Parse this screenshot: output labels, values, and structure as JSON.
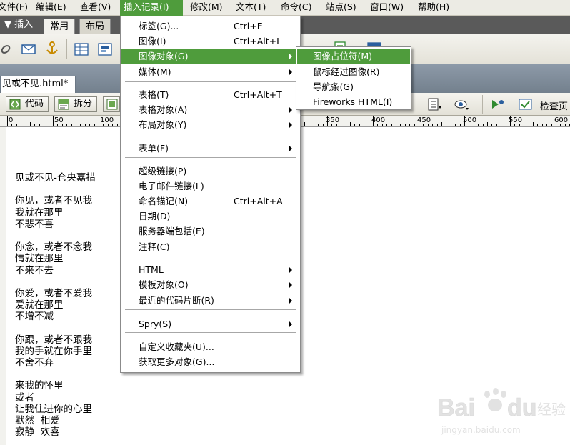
{
  "menubar": {
    "items": [
      "文件(F)",
      "编辑(E)",
      "查看(V)",
      "插入记录(I)",
      "修改(M)",
      "文本(T)",
      "命令(C)",
      "站点(S)",
      "窗口(W)",
      "帮助(H)"
    ]
  },
  "insert_panel": {
    "title": "▼ 插入",
    "tabs": [
      "常用",
      "布局"
    ]
  },
  "document": {
    "tab_label": "见或不见.html*",
    "code_label": "代码",
    "split_label": "拆分",
    "check_label": "检查页",
    "ruler_labels": [
      "0",
      "50",
      "100",
      "350",
      "400",
      "450",
      "500",
      "550",
      "600"
    ],
    "lines": [
      "见或不见-仓央嘉措",
      "",
      "你见，或者不见我",
      "我就在那里",
      "不悲不喜",
      "",
      "你念，或者不念我",
      "情就在那里",
      "不来不去",
      "",
      "你爱，或者不爱我",
      "爱就在那里",
      "不增不减",
      "",
      "你跟，或者不跟我",
      "我的手就在你手里",
      "不舍不弃",
      "",
      "来我的怀里",
      "或者",
      "让我住进你的心里",
      "默然  相爱",
      "寂静  欢喜"
    ]
  },
  "dropdown": {
    "items": [
      {
        "label": "标签(G)...",
        "shortcut": "Ctrl+E"
      },
      {
        "label": "图像(I)",
        "shortcut": "Ctrl+Alt+I"
      },
      {
        "label": "图像对象(G)",
        "submenu": true
      },
      {
        "label": "媒体(M)",
        "submenu": true
      },
      {
        "label": "表格(T)",
        "shortcut": "Ctrl+Alt+T"
      },
      {
        "label": "表格对象(A)",
        "submenu": true
      },
      {
        "label": "布局对象(Y)",
        "submenu": true
      },
      {
        "label": "表单(F)",
        "submenu": true
      },
      {
        "label": "超级链接(P)"
      },
      {
        "label": "电子邮件链接(L)"
      },
      {
        "label": "命名锚记(N)",
        "shortcut": "Ctrl+Alt+A"
      },
      {
        "label": "日期(D)"
      },
      {
        "label": "服务器端包括(E)"
      },
      {
        "label": "注释(C)"
      },
      {
        "label": "HTML",
        "submenu": true
      },
      {
        "label": "模板对象(O)",
        "submenu": true
      },
      {
        "label": "最近的代码片断(R)",
        "submenu": true
      },
      {
        "label": "Spry(S)",
        "submenu": true
      },
      {
        "label": "自定义收藏夹(U)..."
      },
      {
        "label": "获取更多对象(G)..."
      }
    ]
  },
  "submenu": {
    "items": [
      "图像占位符(M)",
      "鼠标经过图像(R)",
      "导航条(G)",
      "Fireworks HTML(I)"
    ]
  },
  "watermark": {
    "brand": "Bai",
    "brand2": "du",
    "cn": "经验",
    "url": "jingyan.baidu.com"
  },
  "colors": {
    "highlight": "#4f9c3c",
    "menubar": "#ecebe4",
    "panel": "#5a5a5a"
  }
}
